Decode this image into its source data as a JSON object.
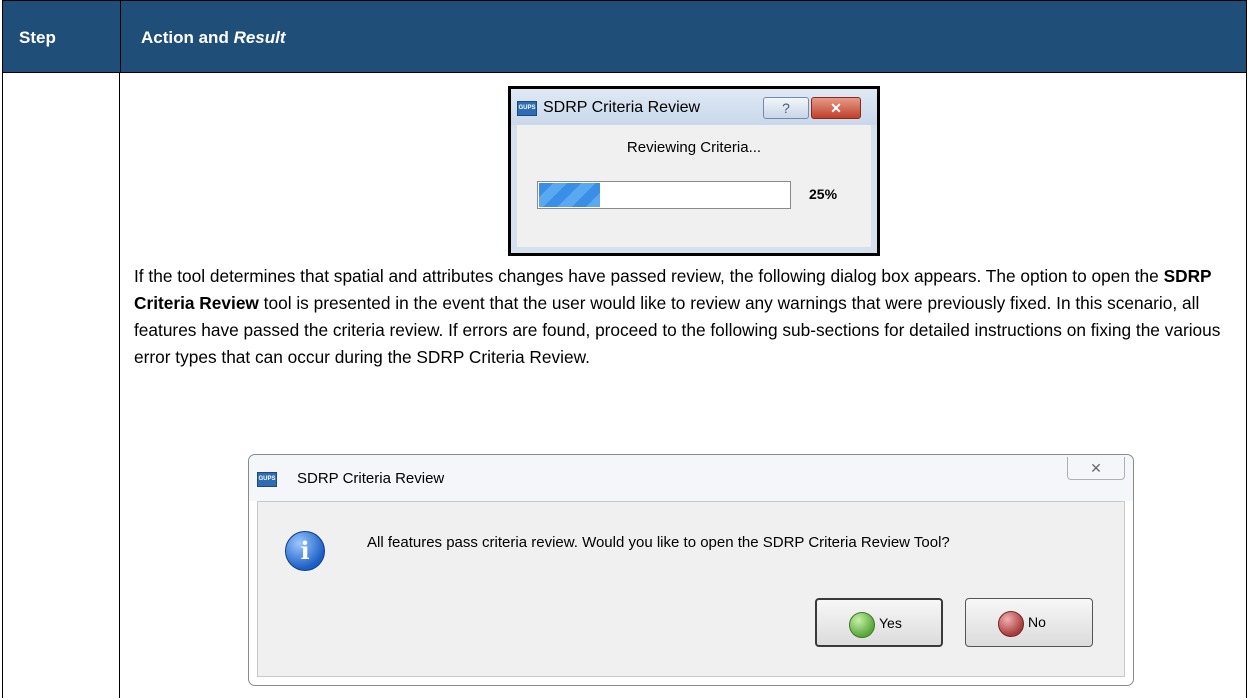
{
  "table": {
    "header_step": "Step",
    "header_action": "Action and ",
    "header_result": "Result"
  },
  "progress_dialog": {
    "icon_text": "GUPS",
    "title": "SDRP Criteria Review",
    "help_label": "?",
    "close_label": "✕",
    "status": "Reviewing Criteria...",
    "progress_fraction": 0.25,
    "percent_label": "25%"
  },
  "paragraph": {
    "part1": "If the tool determines that spatial and attributes changes have passed review, the following dialog box appears. The option to open the ",
    "bold": "SDRP Criteria Review",
    "part2": " tool is presented in the event that the user would like to review any warnings that were previously fixed. In this scenario, all features have passed the criteria review. If errors are found, proceed to the following sub-sections for detailed instructions on fixing the various error types that can occur during the SDRP Criteria Review."
  },
  "message_dialog": {
    "icon_text": "GUPS",
    "title": "SDRP Criteria Review",
    "close_label": "✕",
    "info_glyph": "i",
    "message": "All features pass criteria review. Would you like to open the SDRP Criteria Review Tool?",
    "yes_label": "Yes",
    "no_label": "No"
  },
  "colors": {
    "header_bg": "#1f4e79",
    "progress_fill": "#3a8ee6"
  }
}
